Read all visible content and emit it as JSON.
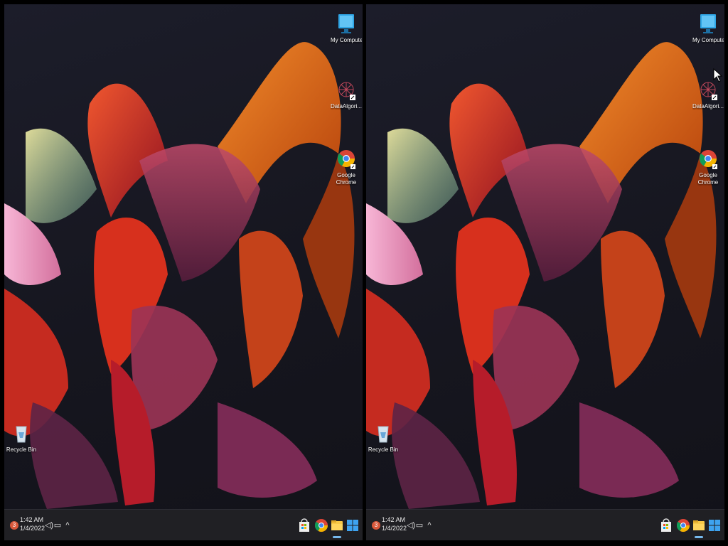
{
  "desktop": {
    "icons": [
      {
        "label": "My Computer",
        "icon": "monitor-icon"
      },
      {
        "label": "DataAlgori...",
        "icon": "dataalgori-app-icon"
      },
      {
        "label": "Google Chrome",
        "label_line1": "Google",
        "label_line2": "Chrome",
        "icon": "chrome-icon"
      },
      {
        "label": "Recycle Bin",
        "icon": "recycle-bin-icon"
      }
    ]
  },
  "taskbar": {
    "time": "1:42 AM",
    "date": "1/4/2022",
    "notification_count": "3",
    "chevron": "^",
    "apps": [
      {
        "name": "store",
        "icon": "store-icon"
      },
      {
        "name": "chrome",
        "icon": "chrome-icon"
      },
      {
        "name": "file-explorer",
        "icon": "folder-icon"
      },
      {
        "name": "start",
        "icon": "windows-start-icon"
      }
    ]
  },
  "colors": {
    "background": "#16161f",
    "taskbar": "#202024",
    "accent": "#76b9ed",
    "ribbon_orange": "#e2620f",
    "ribbon_red": "#c2192a",
    "ribbon_magenta": "#8e2757"
  }
}
